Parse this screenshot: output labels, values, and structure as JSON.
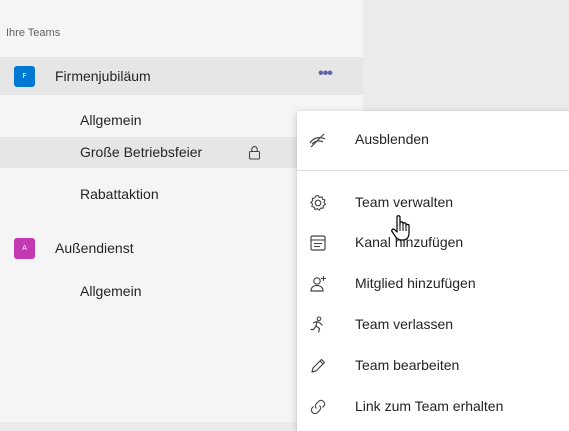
{
  "sidebar": {
    "section_title": "Ihre Teams",
    "teams": [
      {
        "initial": "F",
        "name": "Firmenjubiläum",
        "avatar_color": "#0078d4",
        "more_label": "•••",
        "channels": [
          "Allgemein",
          "Große Betriebsfeier",
          "Rabattaktion"
        ]
      },
      {
        "initial": "A",
        "name": "Außendienst",
        "avatar_color": "#c239b3",
        "channels": [
          "Allgemein"
        ]
      }
    ]
  },
  "context_menu": {
    "items": [
      {
        "label": "Ausblenden",
        "icon": "hide-icon"
      },
      {
        "label": "Team verwalten",
        "icon": "gear-icon"
      },
      {
        "label": "Kanal hinzufügen",
        "icon": "add-channel-icon"
      },
      {
        "label": "Mitglied hinzufügen",
        "icon": "add-member-icon"
      },
      {
        "label": "Team verlassen",
        "icon": "leave-team-icon"
      },
      {
        "label": "Team bearbeiten",
        "icon": "pencil-icon"
      },
      {
        "label": "Link zum Team erhalten",
        "icon": "link-icon"
      }
    ]
  },
  "colors": {
    "accent": "#6264a7",
    "sidebar_bg": "#f5f5f5",
    "hover_bg": "#e6e6e6"
  }
}
